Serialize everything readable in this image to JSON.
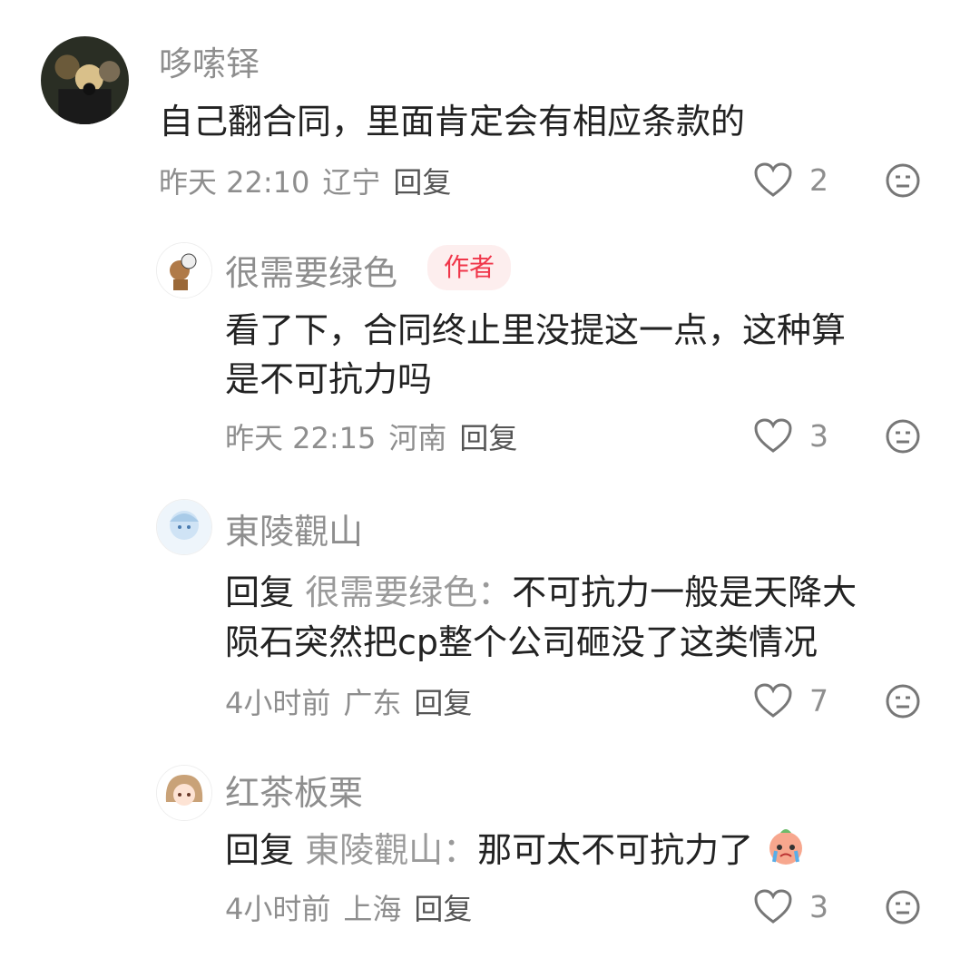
{
  "comments": [
    {
      "user": "哆嗦铎",
      "text_lines": [
        "自己翻合同，里面肯定会有相应条款的"
      ],
      "time": "昨天 22:10",
      "location": "辽宁",
      "reply_label": "回复",
      "likes": "2"
    },
    {
      "user": "很需要绿色",
      "badge": "作者",
      "text_lines": [
        "看了下，合同终止里没提这一点，这种算",
        "是不可抗力吗"
      ],
      "time": "昨天 22:15",
      "location": "河南",
      "reply_label": "回复",
      "likes": "3"
    },
    {
      "user": "東陵觀山",
      "reply_prefix": "回复",
      "reply_target": "很需要绿色：",
      "text_first": "不可抗力一般是天降大",
      "text_second": "陨石突然把cp整个公司砸没了这类情况",
      "time": "4小时前",
      "location": "广东",
      "reply_label": "回复",
      "likes": "7"
    },
    {
      "user": "红茶板栗",
      "reply_prefix": "回复",
      "reply_target": "東陵觀山：",
      "text_first": "那可太不可抗力了",
      "time": "4小时前",
      "location": "上海",
      "reply_label": "回复",
      "likes": "3"
    }
  ],
  "colors": {
    "meta": "#8e8e8e",
    "badge_bg": "#fdeeee",
    "badge_text": "#f0364a"
  }
}
